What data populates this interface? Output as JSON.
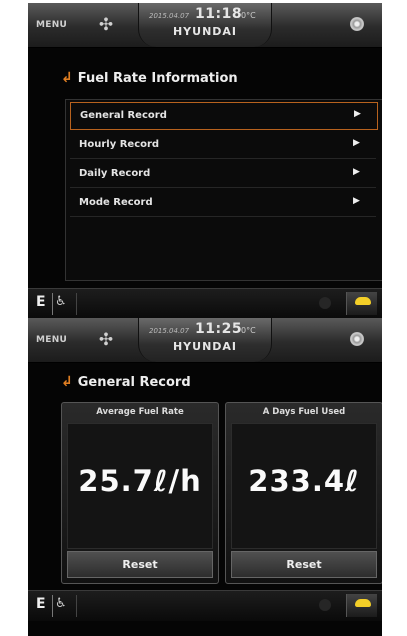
{
  "screen1": {
    "topbar": {
      "menu": "MENU",
      "date": "2015.04.07",
      "time": "11:18",
      "temp": "0°C",
      "brand": "HYUNDAI"
    },
    "page_title": "Fuel Rate Information",
    "items": [
      {
        "label": "General Record"
      },
      {
        "label": "Hourly Record"
      },
      {
        "label": "Daily Record"
      },
      {
        "label": "Mode Record"
      }
    ],
    "selected_index": 0,
    "bottom": {
      "mode": "E"
    }
  },
  "screen2": {
    "topbar": {
      "menu": "MENU",
      "date": "2015.04.07",
      "time": "11:25",
      "temp": "0°C",
      "brand": "HYUNDAI"
    },
    "page_title": "General Record",
    "cards": [
      {
        "title": "Average Fuel Rate",
        "value": "25.7ℓ/h",
        "reset": "Reset"
      },
      {
        "title": "A Days Fuel Used",
        "value": "233.4ℓ",
        "reset": "Reset"
      }
    ],
    "bottom": {
      "mode": "E"
    }
  },
  "icons": {
    "back": "back-arrow-icon",
    "fan": "fan-icon",
    "disc": "disc-icon",
    "seat": "seat-icon",
    "turtle": "turtle-icon",
    "arrow": "chevron-right-icon"
  },
  "colors": {
    "accent": "#e07e22",
    "selected_border": "#b8621e",
    "turtle": "#f4cf28"
  }
}
